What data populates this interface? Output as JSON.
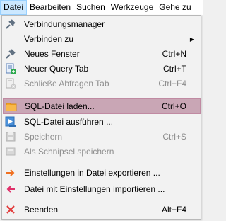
{
  "menubar": {
    "items": [
      "Datei",
      "Bearbeiten",
      "Suchen",
      "Werkzeuge",
      "Gehe zu"
    ]
  },
  "menu": {
    "items": [
      {
        "label": "Verbindungsmanager",
        "shortcut": "",
        "icon": "plug-icon",
        "disabled": false
      },
      {
        "label": "Verbinden zu",
        "shortcut": "",
        "icon": "",
        "disabled": false,
        "submenu": true
      },
      {
        "label": "Neues Fenster",
        "shortcut": "Ctrl+N",
        "icon": "plug-icon",
        "disabled": false
      },
      {
        "label": "Neuer Query Tab",
        "shortcut": "Ctrl+T",
        "icon": "new-tab-icon",
        "disabled": false
      },
      {
        "label": "Schließe Abfragen Tab",
        "shortcut": "Ctrl+F4",
        "icon": "close-tab-icon",
        "disabled": true
      },
      {
        "label": "SQL-Datei laden...",
        "shortcut": "Ctrl+O",
        "icon": "folder-icon",
        "disabled": false,
        "highlighted": true
      },
      {
        "label": "SQL-Datei ausführen ...",
        "shortcut": "",
        "icon": "run-file-icon",
        "disabled": false
      },
      {
        "label": "Speichern",
        "shortcut": "Ctrl+S",
        "icon": "save-icon",
        "disabled": true
      },
      {
        "label": "Als Schnipsel speichern",
        "shortcut": "",
        "icon": "snippet-icon",
        "disabled": true
      },
      {
        "label": "Einstellungen in Datei exportieren ...",
        "shortcut": "",
        "icon": "export-arrow-icon",
        "disabled": false
      },
      {
        "label": "Datei mit Einstellungen importieren ...",
        "shortcut": "",
        "icon": "import-arrow-icon",
        "disabled": false
      },
      {
        "label": "Beenden",
        "shortcut": "Alt+F4",
        "icon": "exit-icon",
        "disabled": false
      }
    ],
    "submenu_arrow": "▶"
  },
  "colors": {
    "highlight": "#c9a6b5",
    "folder": "#f5a623",
    "export_arrow": "#f07020",
    "import_arrow": "#e0306a",
    "exit": "#e23b3b"
  }
}
